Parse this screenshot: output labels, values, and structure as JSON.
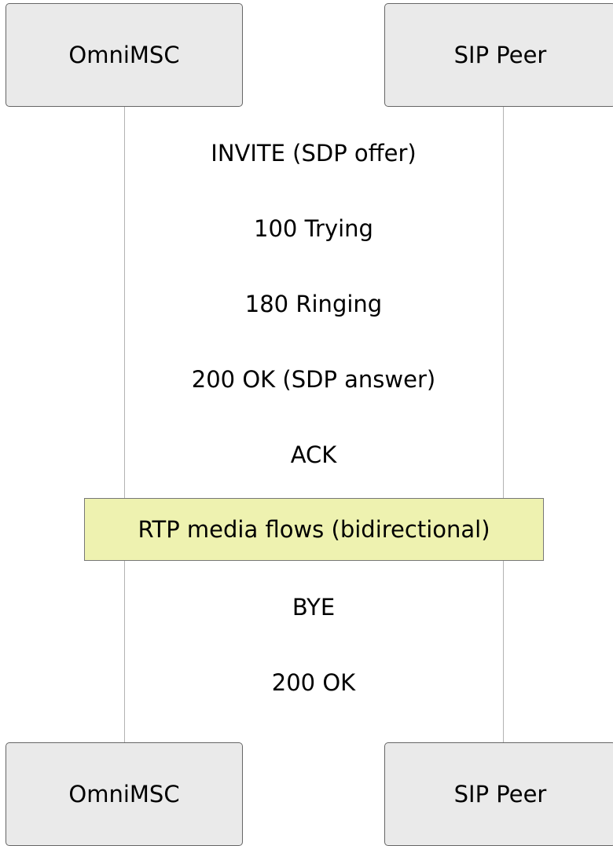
{
  "participants": [
    {
      "id": "omnimsc",
      "label": "OmniMSC"
    },
    {
      "id": "sip-peer",
      "label": "SIP Peer"
    }
  ],
  "messages": [
    {
      "label": "INVITE (SDP offer)"
    },
    {
      "label": "100 Trying"
    },
    {
      "label": "180 Ringing"
    },
    {
      "label": "200 OK (SDP answer)"
    },
    {
      "label": "ACK"
    },
    {
      "label": "BYE"
    },
    {
      "label": "200 OK"
    }
  ],
  "note": {
    "label": "RTP media flows (bidirectional)"
  },
  "colors": {
    "actor_fill": "#eaeaea",
    "actor_border": "#666666",
    "note_fill": "#eef2b0",
    "lifeline": "#b3b3b3"
  }
}
